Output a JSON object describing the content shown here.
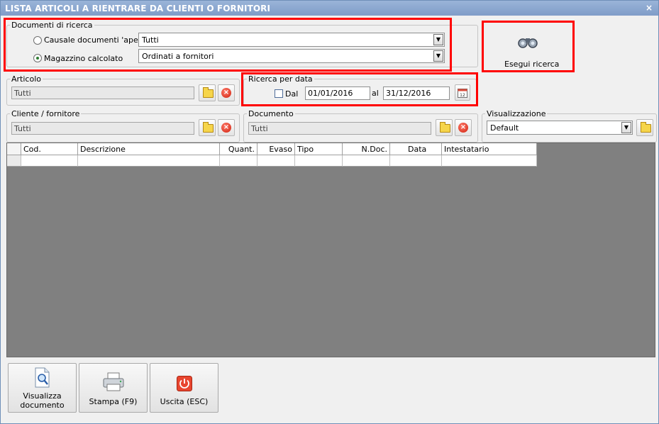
{
  "window": {
    "title": "LISTA ARTICOLI A RIENTRARE DA CLIENTI O FORNITORI",
    "close_glyph": "×"
  },
  "documenti": {
    "legend": "Documenti di ricerca",
    "option1_label": "Causale documenti 'aperti'",
    "option1_value": "Tutti",
    "option2_label": "Magazzino calcolato",
    "option2_value": "Ordinati a fornitori",
    "selected_option": "Magazzino calcolato"
  },
  "esegui": {
    "label": "Esegui ricerca",
    "icon": "binoculars-icon"
  },
  "articolo": {
    "legend": "Articolo",
    "value": "Tutti"
  },
  "ricerca_data": {
    "legend": "Ricerca per data",
    "checkbox_label": "Dal",
    "checked": false,
    "from": "01/01/2016",
    "to_label": "al",
    "to": "31/12/2016"
  },
  "cliente": {
    "legend": "Cliente / fornitore",
    "value": "Tutti"
  },
  "documento": {
    "legend": "Documento",
    "value": "Tutti"
  },
  "visualizzazione": {
    "legend": "Visualizzazione",
    "value": "Default"
  },
  "grid": {
    "columns": [
      "Cod.",
      "Descrizione",
      "Quant.",
      "Evaso",
      "Tipo",
      "N.Doc.",
      "Data",
      "Intestatario"
    ]
  },
  "buttons": {
    "visualizza_line1": "Visualizza",
    "visualizza_line2": "documento",
    "stampa": "Stampa (F9)",
    "uscita": "Uscita (ESC)"
  },
  "colors": {
    "highlight": "#ff0000",
    "titlebar": "#7f9cc8",
    "grid_bg": "#808080"
  }
}
